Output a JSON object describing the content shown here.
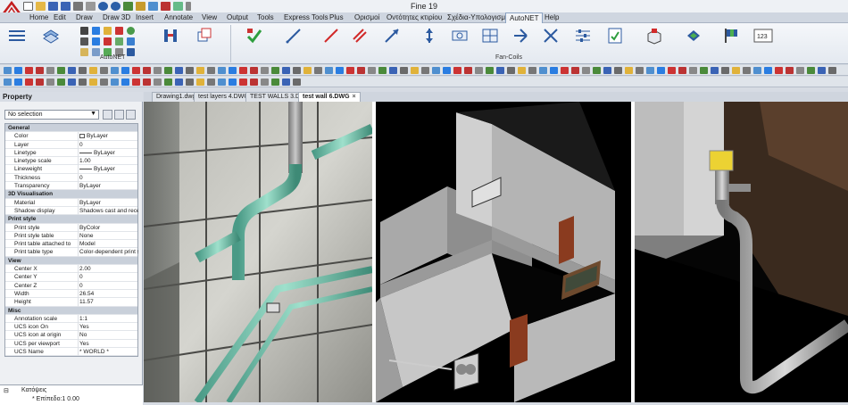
{
  "app": {
    "title": "Fine 19"
  },
  "menu": [
    "Home",
    "Edit",
    "Draw",
    "Draw 3D",
    "Insert",
    "Annotate",
    "View",
    "Output",
    "Tools",
    "Express Tools",
    "Plus",
    "Ορισμοί",
    "Οντότητες κτιρίου",
    "Σχέδια-Υπολογισμοί",
    "AutoNET",
    "Help"
  ],
  "ribbon": {
    "group_left": "AutoNET",
    "group_right": "Fan-Coils"
  },
  "panel": {
    "title": "Property",
    "selection": "No selection",
    "sections": [
      {
        "name": "General",
        "rows": [
          {
            "key": "Color",
            "value": "ByLayer",
            "swatch": true
          },
          {
            "key": "Layer",
            "value": "0"
          },
          {
            "key": "Linetype",
            "value": "ByLayer",
            "line": true
          },
          {
            "key": "Linetype scale",
            "value": "1.00"
          },
          {
            "key": "Lineweight",
            "value": "ByLayer",
            "line": true
          },
          {
            "key": "Thickness",
            "value": "0"
          },
          {
            "key": "Transparency",
            "value": "ByLayer"
          }
        ]
      },
      {
        "name": "3D Visualisation",
        "rows": [
          {
            "key": "Material",
            "value": "ByLayer"
          },
          {
            "key": "Shadow display",
            "value": "Shadows cast and recei..."
          }
        ]
      },
      {
        "name": "Print style",
        "rows": [
          {
            "key": "Print style",
            "value": "ByColor"
          },
          {
            "key": "Print style table",
            "value": "None"
          },
          {
            "key": "Print table attached to",
            "value": "Model"
          },
          {
            "key": "Print table type",
            "value": "Color-dependent print style"
          }
        ]
      },
      {
        "name": "View",
        "rows": [
          {
            "key": "Center X",
            "value": "2.00"
          },
          {
            "key": "Center Y",
            "value": "0"
          },
          {
            "key": "Center Z",
            "value": "0"
          },
          {
            "key": "Width",
            "value": "26.54"
          },
          {
            "key": "Height",
            "value": "11.57"
          }
        ]
      },
      {
        "name": "Misc",
        "rows": [
          {
            "key": "Annotation scale",
            "value": "1:1"
          },
          {
            "key": "UCS icon On",
            "value": "Yes"
          },
          {
            "key": "UCS icon at origin",
            "value": "No"
          },
          {
            "key": "UCS per viewport",
            "value": "Yes"
          },
          {
            "key": "UCS Name",
            "value": "* WORLD *"
          }
        ]
      }
    ]
  },
  "tree": {
    "root": "Κατόψεις",
    "child": "* Επίπεδο:1  0.00"
  },
  "doc_tabs": [
    {
      "label": "Drawing1.dwg",
      "active": false
    },
    {
      "label": "test layers 4.DWG",
      "active": false
    },
    {
      "label": "TEST WALLS 3.DWG",
      "active": false
    },
    {
      "label": "test wall 6.DWG",
      "active": true
    }
  ]
}
